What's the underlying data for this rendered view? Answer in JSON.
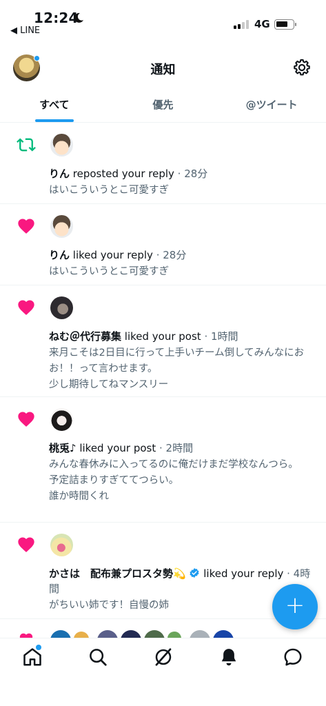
{
  "status_bar": {
    "time": "12:24",
    "moon_icon": "crescent-moon-icon",
    "back_app": "◀ LINE",
    "network": "4G",
    "signal_bars": 2
  },
  "header": {
    "title": "通知",
    "has_unread_dot": true
  },
  "tabs": [
    {
      "label": "すべて",
      "active": true
    },
    {
      "label": "優先",
      "active": false
    },
    {
      "label": "@ツイート",
      "active": false
    }
  ],
  "notifications": [
    {
      "type": "repost",
      "icon": "repost-icon",
      "user": "りん",
      "action": " reposted your reply",
      "time": " · 28分",
      "text": [
        "はいこういうとこ可愛すぎ"
      ]
    },
    {
      "type": "like",
      "icon": "heart-icon",
      "user": "りん",
      "action": " liked your reply",
      "time": " · 28分",
      "text": [
        "はいこういうとこ可愛すぎ"
      ]
    },
    {
      "type": "like",
      "icon": "heart-icon",
      "user": "ねむ＠代行募集",
      "action": " liked your post",
      "time": " · 1時間",
      "text": [
        "来月こそは2日目に行って上手いチーム倒してみんなにおお！！って言わせます。",
        "少し期待してねマンスリー"
      ]
    },
    {
      "type": "like",
      "icon": "heart-icon",
      "user": "桃兎♪",
      "action": " liked your post",
      "time": " · 2時間",
      "text": [
        "みんな春休みに入ってるのに俺だけまだ学校なんつら。",
        "予定詰まりすぎててつらい。",
        "誰か時間くれ"
      ]
    },
    {
      "type": "like",
      "icon": "heart-icon",
      "user": "かさは　配布兼プロスタ勢💫",
      "action": " liked your reply",
      "time": " · 4時間",
      "verified": true,
      "text": [
        "がちいい姉です！自慢の姉"
      ]
    }
  ],
  "fab": {
    "label": "+"
  },
  "colors": {
    "accent": "#1d9bf0",
    "like": "#f91880",
    "repost": "#00ba7c",
    "secondary_text": "#536471"
  }
}
